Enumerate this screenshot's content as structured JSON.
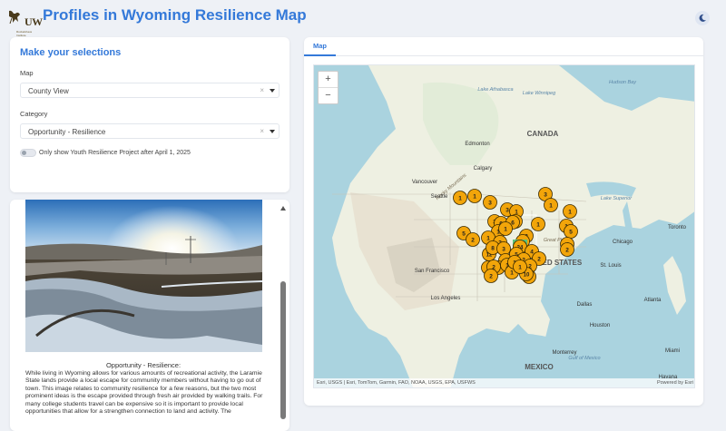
{
  "header": {
    "logo_text": "UW",
    "logo_subtext": "Ruckelshaus Institute",
    "title": "Profiles in Wyoming Resilience Map"
  },
  "selections": {
    "heading": "Make your selections",
    "map_label": "Map",
    "map_value": "County View",
    "category_label": "Category",
    "category_value": "Opportunity - Resilience",
    "toggle_label": "Only show Youth Resilience Project after April 1, 2025",
    "toggle_on": false
  },
  "story": {
    "caption_title": "Opportunity - Resilience:",
    "caption_body": "While living in Wyoming allows for various amounts of recreational activity, the Laramie State lands provide a local escape for community members without having to go out of town. This image relates to community resilience for a few reasons, but the two most prominent ideas is the escape provided through fresh air provided by walking trails. For many college students travel can be expensive so it is important to provide local opportunities that allow for a strengthen connection to land and activity. The"
  },
  "map": {
    "tab_label": "Map",
    "zoom_in": "+",
    "zoom_out": "−",
    "attribution": "Esri, USGS | Esri, TomTom, Garmin, FAO, NOAA, USGS, EPA, USFWS",
    "powered_by": "Powered by Esri",
    "labels": [
      {
        "text": "Lake Athabasca",
        "kind": "water"
      },
      {
        "text": "Edmonton",
        "kind": "city"
      },
      {
        "text": "CANADA",
        "kind": "country"
      },
      {
        "text": "Calgary",
        "kind": "city"
      },
      {
        "text": "Hudson Bay",
        "kind": "water"
      },
      {
        "text": "Lake Winnipeg",
        "kind": "water"
      },
      {
        "text": "Rocky Mountains",
        "kind": "terrain"
      },
      {
        "text": "Seattle",
        "kind": "city"
      },
      {
        "text": "Vancouver",
        "kind": "city"
      },
      {
        "text": "Lake Superior",
        "kind": "water"
      },
      {
        "text": "Toronto",
        "kind": "city"
      },
      {
        "text": "Chicago",
        "kind": "city"
      },
      {
        "text": "Great Plains",
        "kind": "terrain"
      },
      {
        "text": "UNITED STATES",
        "kind": "country"
      },
      {
        "text": "St. Louis",
        "kind": "city"
      },
      {
        "text": "San Francisco",
        "kind": "city"
      },
      {
        "text": "Los Angeles",
        "kind": "city"
      },
      {
        "text": "Dallas",
        "kind": "city"
      },
      {
        "text": "Atlanta",
        "kind": "city"
      },
      {
        "text": "Houston",
        "kind": "city"
      },
      {
        "text": "Gulf of Mexico",
        "kind": "water"
      },
      {
        "text": "Monterrey",
        "kind": "city"
      },
      {
        "text": "MEXICO",
        "kind": "country"
      },
      {
        "text": "Miami",
        "kind": "city"
      },
      {
        "text": "Havana",
        "kind": "city"
      }
    ],
    "cluster_counts": [
      "3",
      "1",
      "1",
      "3",
      "1",
      "3",
      "1",
      "1",
      "1",
      "2",
      "3",
      "6",
      "1",
      "6",
      "1",
      "3",
      "5",
      "2",
      "1",
      "5",
      "1",
      "5",
      "4",
      "2",
      "3",
      "12",
      "24",
      "8",
      "3",
      "1",
      "1",
      "2",
      "1",
      "4",
      "5",
      "2",
      "2",
      "2",
      "2",
      "10",
      "1",
      "2",
      "1",
      "1",
      "2"
    ],
    "highlight_cluster": "24",
    "marker_color": "#f2a50a",
    "highlight_color": "#5ec37a"
  }
}
